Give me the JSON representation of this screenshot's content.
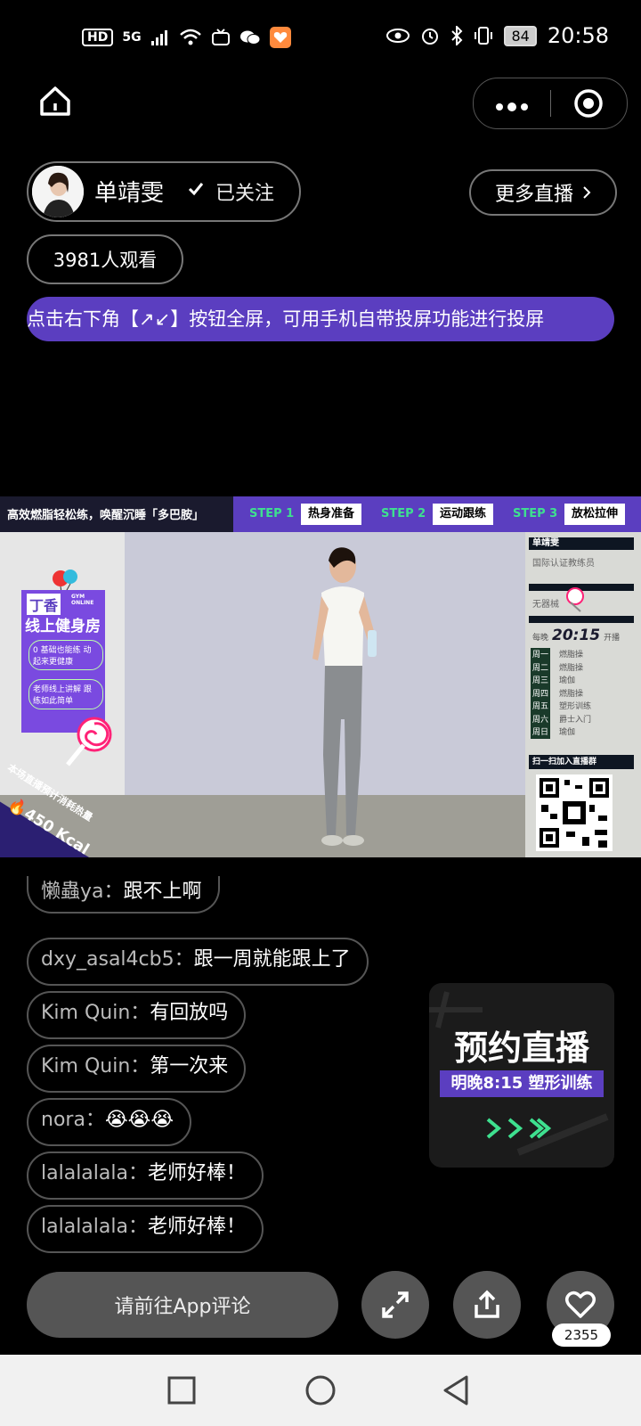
{
  "status_bar": {
    "hd": "HD",
    "net": "5G",
    "battery": "84",
    "time": "20:58",
    "icons": [
      "signal-icon",
      "wifi-icon",
      "tv-icon",
      "wechat-icon",
      "app-badge-icon",
      "eye-icon",
      "alarm-icon",
      "bluetooth-icon",
      "vibrate-icon"
    ]
  },
  "host": {
    "name": "单靖雯",
    "follow_label": "已关注"
  },
  "more_live_label": "更多直播",
  "viewers_label": "3981人观看",
  "notice": "点击右下角【↗↙】按钮全屏，可用手机自带投屏功能进行投屏",
  "video": {
    "banner": "高效燃脂轻松练，唤醒沉睡「多巴胺」",
    "steps": [
      {
        "tag": "STEP 1",
        "label": "热身准备"
      },
      {
        "tag": "STEP 2",
        "label": "运动跟练"
      },
      {
        "tag": "STEP 3",
        "label": "放松拉伸"
      }
    ],
    "logo_top": "丁香",
    "logo_en": "GYM ONLINE",
    "logo_main": "线上健身房",
    "logo_tips": [
      "0 基础也能练 动起来更健康",
      "老师线上讲解 跟练如此简单"
    ],
    "kcal_caption": "本场直播预计消耗热量",
    "kcal": "450 Kcal",
    "coach_name": "单靖雯",
    "coach_title": "国际认证教练员",
    "equipment": "无器械",
    "schedule_prefix": "每晚",
    "schedule_time": "20:15",
    "schedule_suffix": "开播",
    "schedule": [
      {
        "day": "周一",
        "item": "燃脂操"
      },
      {
        "day": "周二",
        "item": "燃脂操"
      },
      {
        "day": "周三",
        "item": "瑜伽"
      },
      {
        "day": "周四",
        "item": "燃脂操"
      },
      {
        "day": "周五",
        "item": "塑形训练"
      },
      {
        "day": "周六",
        "item": "爵士入门"
      },
      {
        "day": "周日",
        "item": "瑜伽"
      }
    ],
    "qr_caption": "扫一扫加入直播群"
  },
  "comments": [
    {
      "name": "懒蟲ya：",
      "text": "跟不上啊"
    },
    {
      "name": "dxy_asal4cb5：",
      "text": "跟一周就能跟上了"
    },
    {
      "name": "Kim Quin：",
      "text": "有回放吗"
    },
    {
      "name": "Kim Quin：",
      "text": "第一次来"
    },
    {
      "name": "nora：",
      "text": "😭😭😭"
    },
    {
      "name": "lalalalala：",
      "text": "老师好棒！"
    },
    {
      "name": "lalalalala：",
      "text": "老师好棒！"
    }
  ],
  "promo": {
    "title": "预约直播",
    "subtitle": "明晚8:15  塑形训练"
  },
  "bottom": {
    "comment_placeholder": "请前往App评论",
    "like_count": "2355"
  },
  "colors": {
    "accent_purple": "#5b3ec0",
    "accent_green": "#3ee08f"
  }
}
